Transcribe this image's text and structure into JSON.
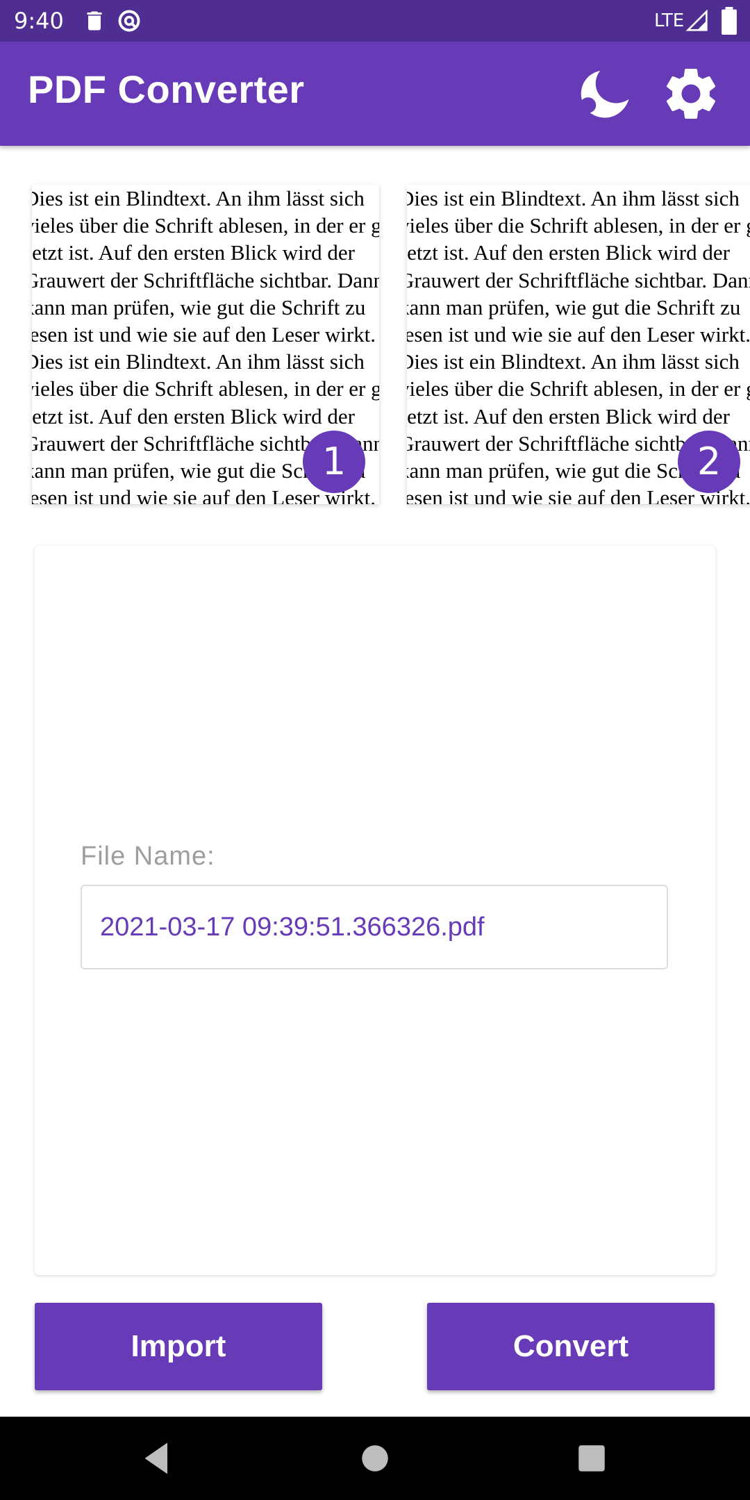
{
  "status_bar": {
    "time": "9:40",
    "left_icons": [
      "trash-icon",
      "no-sim-circle-icon"
    ],
    "network": "LTE",
    "signal_icon": "signal-icon",
    "battery_icon": "battery-icon"
  },
  "app_bar": {
    "title": "PDF Converter",
    "actions": [
      "night-mode-icon",
      "settings-icon"
    ]
  },
  "thumbnails": [
    {
      "badge": "1",
      "lines": [
        "Dies ist ein Blindtext. An ihm lässt sich",
        "vieles über die Schrift ablesen, in der er ge",
        "setzt ist. Auf den ersten Blick wird der",
        "Grauwert der Schriftfläche sichtbar. Dann",
        "kann man prüfen, wie gut die Schrift zu",
        "lesen ist und wie sie auf den Leser wirkt.",
        "Dies ist ein Blindtext. An ihm lässt sich",
        "vieles über die Schrift ablesen, in der er ge",
        "setzt ist. Auf den ersten Blick wird der",
        "Grauwert der Schriftfläche sichtbar. Dann",
        "kann man prüfen, wie gut die Schrift zu",
        "lesen ist und wie sie auf den Leser wirkt."
      ]
    },
    {
      "badge": "2",
      "lines": [
        "Dies ist ein Blindtext. An ihm lässt sich",
        "vieles über die Schrift ablesen, in der er ge",
        "setzt ist. Auf den ersten Blick wird der",
        "Grauwert der Schriftfläche sichtbar. Dann",
        "kann man prüfen, wie gut die Schrift zu",
        "lesen ist und wie sie auf den Leser wirkt.",
        "Dies ist ein Blindtext. An ihm lässt sich",
        "vieles über die Schrift ablesen, in der er ge",
        "setzt ist. Auf den ersten Blick wird der",
        "Grauwert der Schriftfläche sichtbar. Dann",
        "kann man prüfen, wie gut die Schrift zu",
        "lesen ist und wie sie auf den Leser wirkt."
      ]
    }
  ],
  "card": {
    "file_label": "File Name:",
    "file_name": "2021-03-17 09:39:51.366326.pdf"
  },
  "buttons": {
    "import_label": "Import",
    "convert_label": "Convert"
  },
  "nav": [
    "back-icon",
    "home-icon",
    "recents-icon"
  ],
  "colors": {
    "primary": "#673ab7",
    "primary_dark": "#4f2d91"
  }
}
